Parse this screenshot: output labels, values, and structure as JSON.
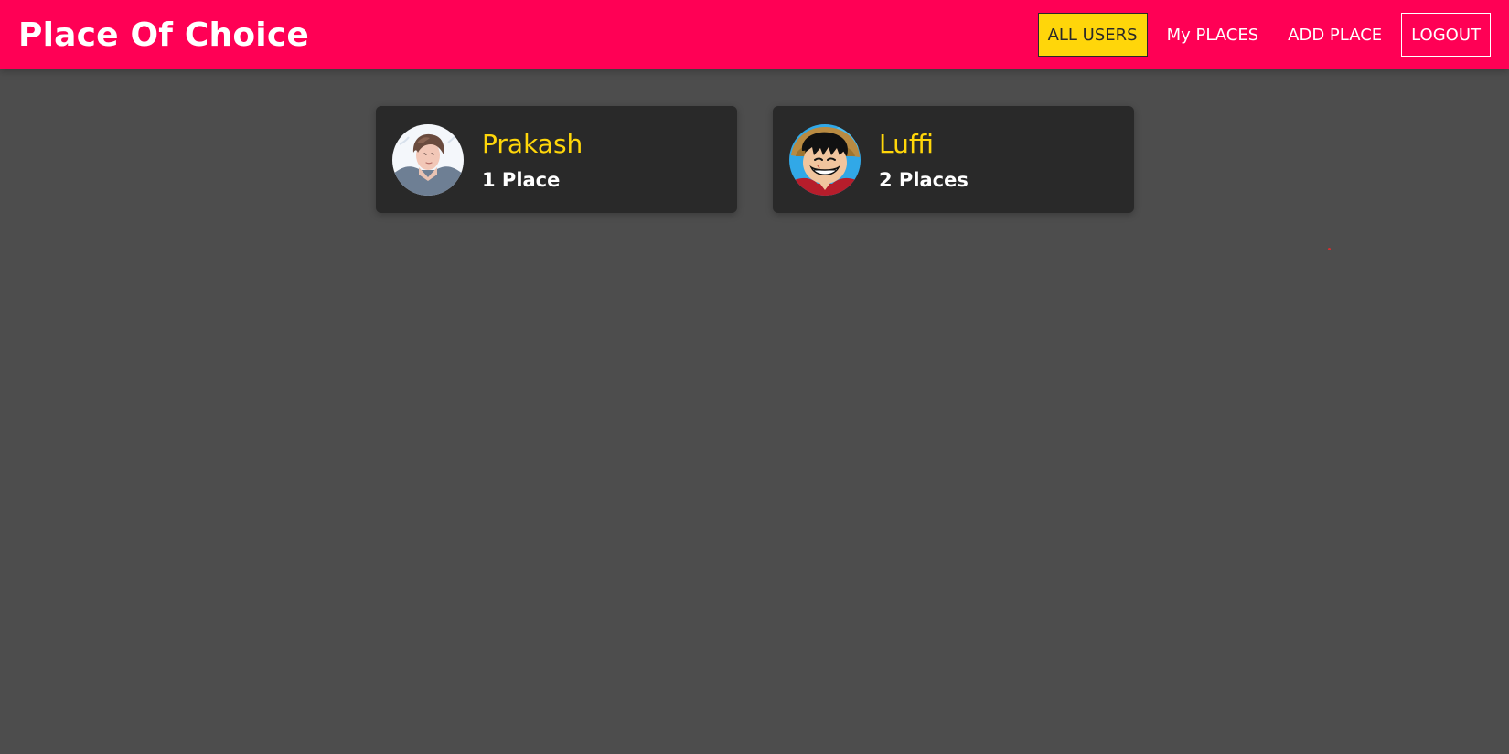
{
  "header": {
    "title": "Place Of Choice",
    "nav": {
      "all_users": "ALL USERS",
      "my_places": "My PLACES",
      "add_place": "ADD PLACE",
      "logout": "LOGOUT"
    }
  },
  "users": [
    {
      "name": "Prakash",
      "places": "1 Place",
      "avatar_icon": "anime-boy-avatar"
    },
    {
      "name": "Luffi",
      "places": "2 Places",
      "avatar_icon": "luffy-avatar"
    }
  ],
  "colors": {
    "header_bg": "#ff0055",
    "page_bg": "#4d4d4d",
    "card_bg": "#292929",
    "accent": "#ffd60a",
    "text": "#ffffff"
  }
}
